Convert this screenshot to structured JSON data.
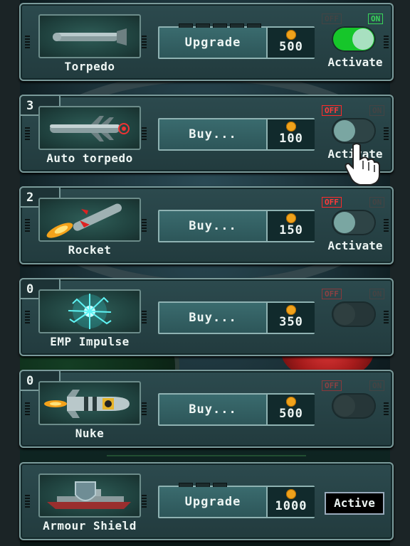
{
  "items": [
    {
      "name": "Torpedo",
      "count": "",
      "button": "Upgrade",
      "price": "500",
      "off": "OFF",
      "on": "ON",
      "state": "on",
      "activate": "Activate"
    },
    {
      "name": "Auto torpedo",
      "count": "3",
      "button": "Buy...",
      "price": "100",
      "off": "OFF",
      "on": "ON",
      "state": "off",
      "activate": "Activate"
    },
    {
      "name": "Rocket",
      "count": "2",
      "button": "Buy...",
      "price": "150",
      "off": "OFF",
      "on": "ON",
      "state": "off",
      "activate": "Activate"
    },
    {
      "name": "EMP Impulse",
      "count": "0",
      "button": "Buy...",
      "price": "350",
      "off": "OFF",
      "on": "ON",
      "state": "disabled",
      "activate": ""
    },
    {
      "name": "Nuke",
      "count": "0",
      "button": "Buy...",
      "price": "500",
      "off": "OFF",
      "on": "ON",
      "state": "disabled",
      "activate": ""
    },
    {
      "name": "Armour Shield",
      "count": "",
      "button": "Upgrade",
      "price": "1000",
      "active_label": "Active"
    }
  ],
  "colors": {
    "coin": "#f0a21b",
    "toggle_on": "#16c62a",
    "tag_off": "#ff2a2a",
    "tag_on": "#39d65a"
  },
  "icons": [
    "torpedo-icon",
    "auto-torpedo-icon",
    "rocket-icon",
    "emp-icon",
    "nuke-icon",
    "shield-ship-icon",
    "coin-icon",
    "hand-pointer-icon"
  ]
}
